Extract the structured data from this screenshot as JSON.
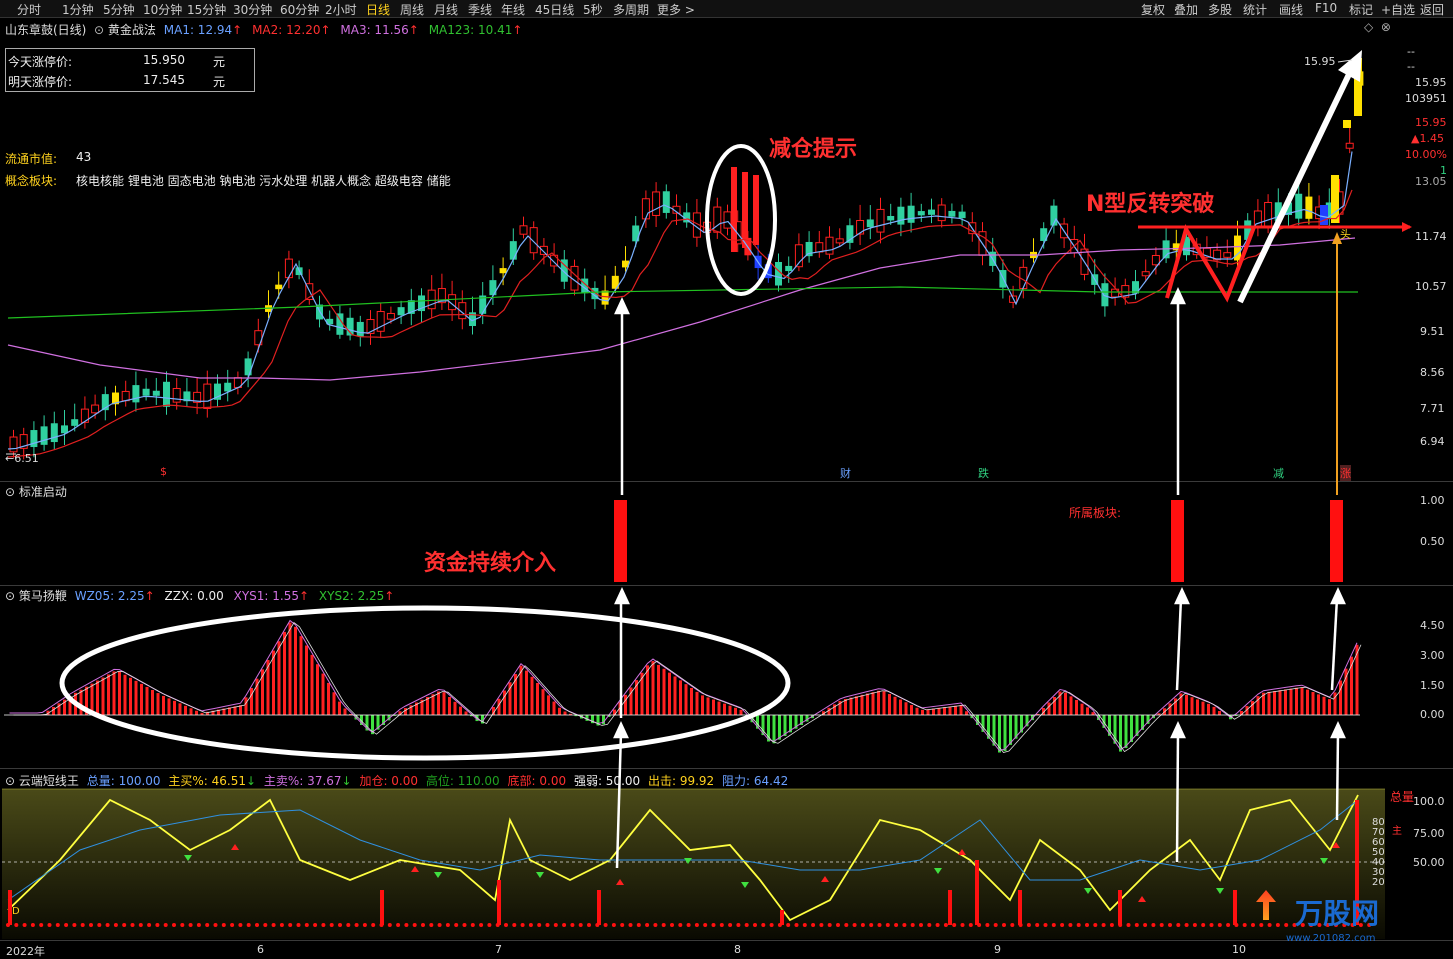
{
  "toolbar": {
    "periods": [
      "分时",
      "1分钟",
      "5分钟",
      "10分钟",
      "15分钟",
      "30分钟",
      "60分钟",
      "2小时",
      "日线",
      "周线",
      "月线",
      "季线",
      "年线",
      "45日线",
      "5秒",
      "多周期",
      "更多 >"
    ],
    "active_period": "日线",
    "right_tools": [
      "复权",
      "叠加",
      "多股",
      "统计",
      "画线",
      "F10",
      "标记",
      "+自选",
      "返回"
    ]
  },
  "main_header": {
    "stock": "山东章鼓(日线)",
    "indicator": "黄金战法",
    "ma1": "MA1: 12.94",
    "ma2": "MA2: 12.20",
    "ma3": "MA3: 11.56",
    "ma123": "MA123: 10.41"
  },
  "limit_box": {
    "row1_label": "今天涨停价:",
    "row1_value": "15.950",
    "row1_unit": "元",
    "row2_label": "明天涨停价:",
    "row2_value": "17.545",
    "row2_unit": "元"
  },
  "info": {
    "float_cap_label": "流通市值:",
    "float_cap_value": "43",
    "concept_label": "概念板块:",
    "concept_value": "核电核能 锂电池 固态电池 钠电池 污水处理 机器人概念 超级电容 储能"
  },
  "annotations": {
    "reduce": "减仓提示",
    "n_break": "N型反转突破",
    "capital": "资金持续介入",
    "sector": "所属板块:",
    "low_price": "6.51",
    "high_price": "15.95",
    "tou": "头",
    "sig_dollar": "$",
    "sig_cai": "财",
    "sig_die": "跌",
    "sig_jian": "减",
    "sig_zhang": "涨"
  },
  "main_axis": {
    "dash1": "--",
    "dash2": "--",
    "price": "15.95",
    "volume": "103951",
    "price_red": "15.95",
    "change": "▲1.45",
    "pct": "10.00%",
    "one": "1",
    "ticks": [
      "13.05",
      "11.74",
      "10.57",
      "9.51",
      "8.56",
      "7.71",
      "6.94"
    ]
  },
  "panel2": {
    "title": "标准启动",
    "ticks": [
      "1.00",
      "0.50"
    ]
  },
  "panel3": {
    "title": "策马扬鞭",
    "wz": "WZ05: 2.25",
    "zzx": "ZZX: 0.00",
    "xys1": "XYS1: 1.55",
    "xys2": "XYS2: 2.25",
    "ticks": [
      "4.50",
      "3.00",
      "1.50",
      "0.00"
    ]
  },
  "panel4": {
    "title": "云端短线王",
    "items": [
      "总量: 100.00",
      "主买%: 46.51",
      "主卖%: 37.67",
      "加仓: 0.00",
      "高位: 110.00",
      "底部: 0.00",
      "强弱: 50.00",
      "出击: 99.92",
      "阻力: 64.42"
    ],
    "ticks": [
      "100.0",
      "75.00",
      "50.00"
    ],
    "mini_ticks": [
      "80",
      "70",
      "60",
      "50",
      "40",
      "30",
      "20"
    ],
    "total_label": "总量",
    "zhu": "主",
    "d_label": "D"
  },
  "x_axis": {
    "labels": [
      "2022年",
      "6",
      "7",
      "8",
      "9",
      "10"
    ]
  },
  "watermark": {
    "brand": "万股网",
    "url": "www.201082.com"
  },
  "colors": {
    "up": "#ff2020",
    "down": "#30d0a0",
    "yellow": "#ffe000",
    "blue": "#2040ff",
    "ma_white": "#ddd",
    "ma_red": "#e02020",
    "ma_purple": "#d070e0",
    "ma_green": "#20c020"
  }
}
